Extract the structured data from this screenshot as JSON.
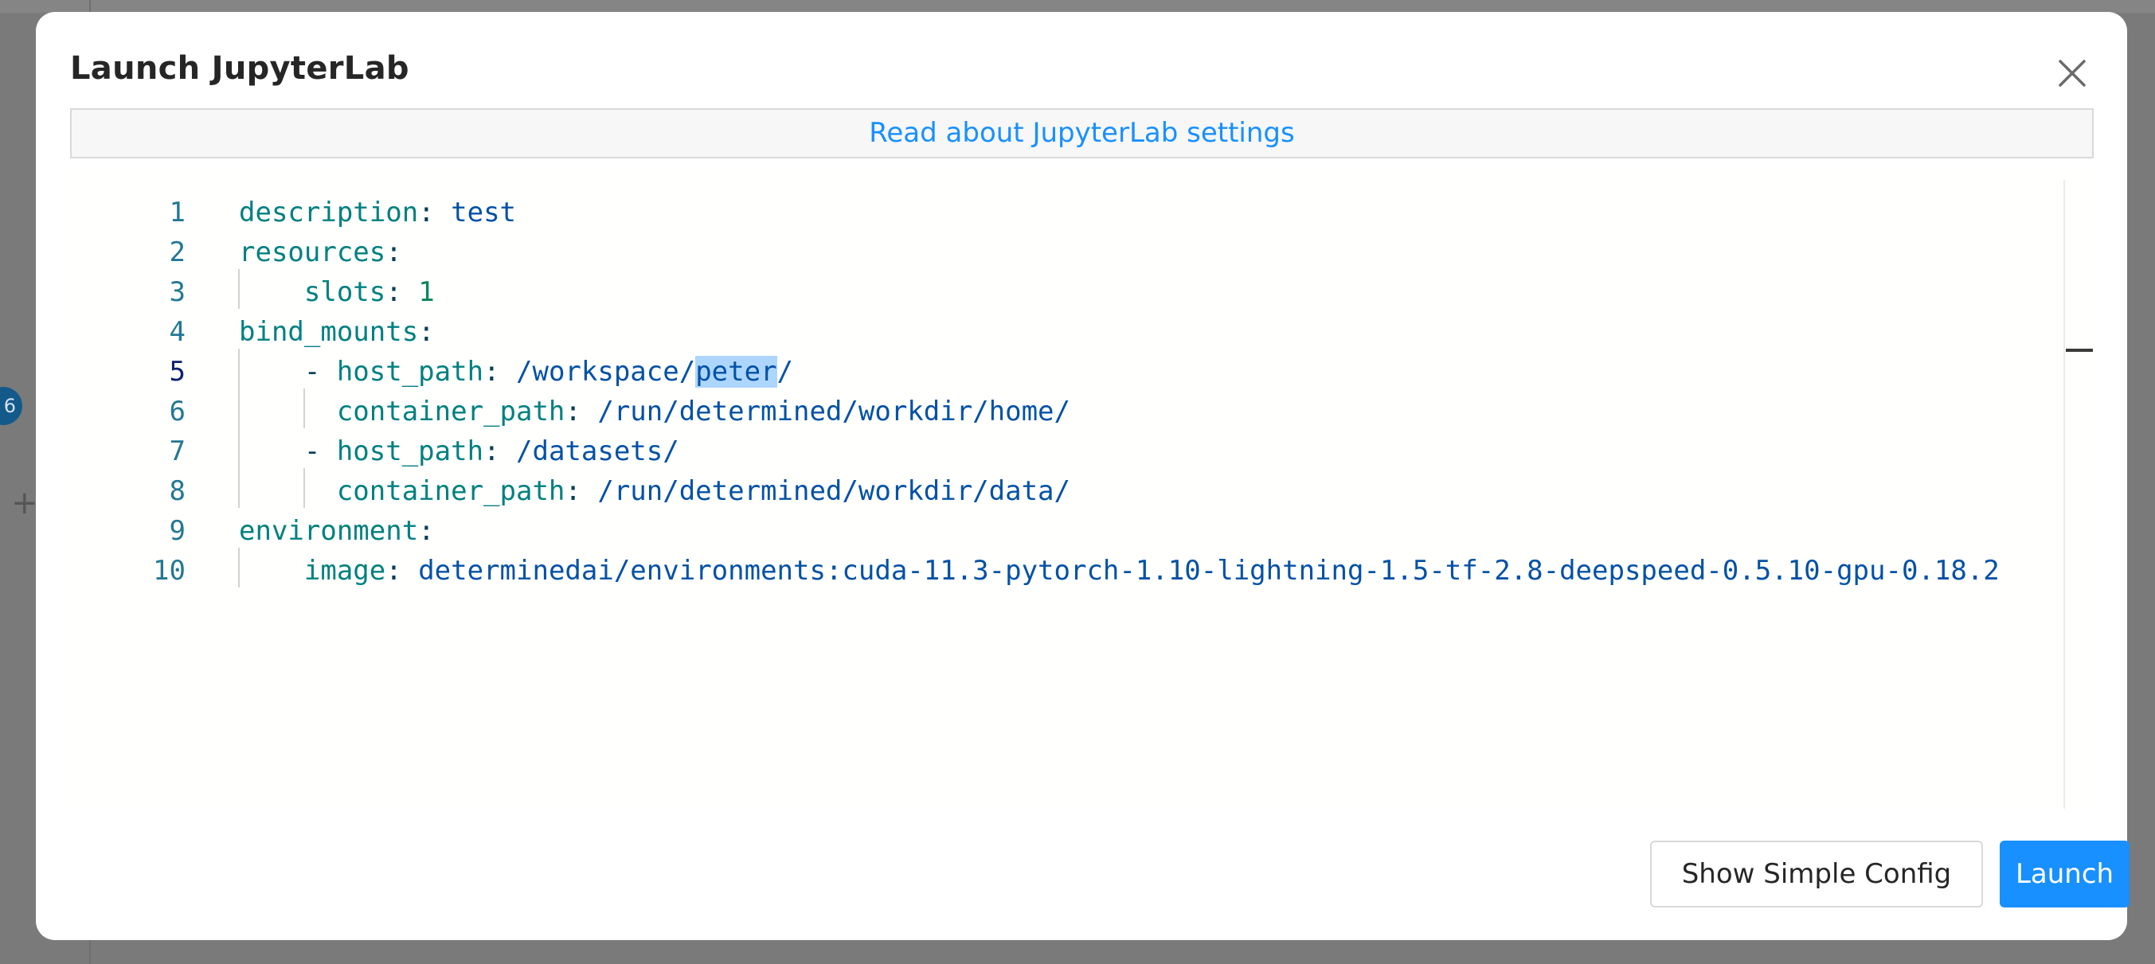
{
  "modal": {
    "title": "Launch JupyterLab",
    "settings_link": "Read about JupyterLab settings"
  },
  "editor": {
    "lines": [
      {
        "num": "1",
        "parts": [
          {
            "t": "description",
            "c": "key"
          },
          {
            "t": ": ",
            "c": "punc"
          },
          {
            "t": "test",
            "c": "val"
          }
        ]
      },
      {
        "num": "2",
        "parts": [
          {
            "t": "resources",
            "c": "key"
          },
          {
            "t": ":",
            "c": "punc"
          }
        ]
      },
      {
        "num": "3",
        "parts": [
          {
            "t": "    ",
            "c": "punc"
          },
          {
            "t": "slots",
            "c": "key"
          },
          {
            "t": ": ",
            "c": "punc"
          },
          {
            "t": "1",
            "c": "num"
          }
        ]
      },
      {
        "num": "4",
        "parts": [
          {
            "t": "bind_mounts",
            "c": "key"
          },
          {
            "t": ":",
            "c": "punc"
          }
        ]
      },
      {
        "num": "5",
        "parts": [
          {
            "t": "    - ",
            "c": "punc"
          },
          {
            "t": "host_path",
            "c": "key"
          },
          {
            "t": ": ",
            "c": "punc"
          },
          {
            "t": "/workspace/",
            "c": "val"
          },
          {
            "t": "peter",
            "c": "val sel"
          },
          {
            "t": "/",
            "c": "val"
          }
        ]
      },
      {
        "num": "6",
        "parts": [
          {
            "t": "      ",
            "c": "punc"
          },
          {
            "t": "container_path",
            "c": "key"
          },
          {
            "t": ": ",
            "c": "punc"
          },
          {
            "t": "/run/determined/workdir/home/",
            "c": "val"
          }
        ]
      },
      {
        "num": "7",
        "parts": [
          {
            "t": "    - ",
            "c": "punc"
          },
          {
            "t": "host_path",
            "c": "key"
          },
          {
            "t": ": ",
            "c": "punc"
          },
          {
            "t": "/datasets/",
            "c": "val"
          }
        ]
      },
      {
        "num": "8",
        "parts": [
          {
            "t": "      ",
            "c": "punc"
          },
          {
            "t": "container_path",
            "c": "key"
          },
          {
            "t": ": ",
            "c": "punc"
          },
          {
            "t": "/run/determined/workdir/data/",
            "c": "val"
          }
        ]
      },
      {
        "num": "9",
        "parts": [
          {
            "t": "environment",
            "c": "key"
          },
          {
            "t": ":",
            "c": "punc"
          }
        ]
      },
      {
        "num": "10",
        "parts": [
          {
            "t": "    ",
            "c": "punc"
          },
          {
            "t": "image",
            "c": "key"
          },
          {
            "t": ": ",
            "c": "punc"
          },
          {
            "t": "determinedai/environments:cuda-11.3-pytorch-1.10-lightning-1.5-tf-2.8-deepspeed-0.5.10-gpu-0.18.2",
            "c": "val"
          }
        ]
      }
    ],
    "active_line": "5"
  },
  "footer": {
    "secondary_label": "Show Simple Config",
    "primary_label": "Launch"
  },
  "colors": {
    "primary": "#1890ff",
    "link": "#1890ff",
    "selection": "#add6ff"
  },
  "icons": {
    "close": "close-icon"
  },
  "background": {
    "badge_text": "6"
  }
}
